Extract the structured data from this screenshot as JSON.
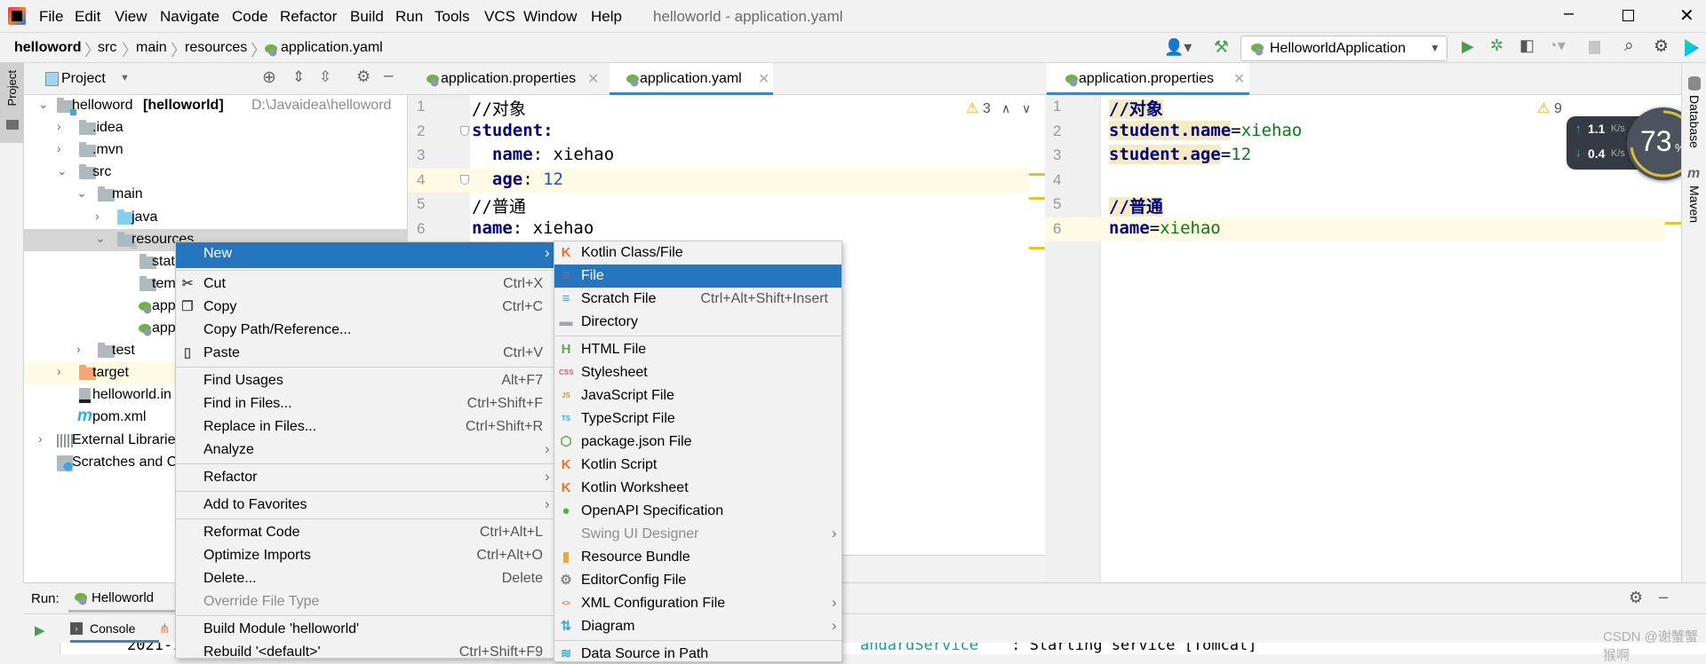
{
  "menubar": {
    "items": [
      "File",
      "Edit",
      "View",
      "Navigate",
      "Code",
      "Refactor",
      "Build",
      "Run",
      "Tools",
      "VCS",
      "Window",
      "Help"
    ],
    "window_title": "helloworld - application.yaml"
  },
  "breadcrumb": [
    "helloword",
    "src",
    "main",
    "resources",
    "application.yaml"
  ],
  "toolbar": {
    "run_config": "HelloworldApplication"
  },
  "left_stripe": {
    "project_tab": "Project"
  },
  "project_panel": {
    "title": "Project",
    "tree": [
      {
        "label": "helloword",
        "module": "[helloworld]",
        "path": "D:\\Javaidea\\helloword",
        "level": 0,
        "arrow": "down",
        "icon": "module"
      },
      {
        "label": ".idea",
        "level": 1,
        "arrow": "right",
        "icon": "folder"
      },
      {
        "label": ".mvn",
        "level": 1,
        "arrow": "right",
        "icon": "folder"
      },
      {
        "label": "src",
        "level": 1,
        "arrow": "down",
        "icon": "folder"
      },
      {
        "label": "main",
        "level": 2,
        "arrow": "down",
        "icon": "folder"
      },
      {
        "label": "java",
        "level": 3,
        "arrow": "right",
        "icon": "source-folder"
      },
      {
        "label": "resources",
        "level": 3,
        "arrow": "down",
        "icon": "resources-folder",
        "selected": true
      },
      {
        "label": "stat",
        "level": 4,
        "icon": "folder"
      },
      {
        "label": "tem",
        "level": 4,
        "icon": "folder"
      },
      {
        "label": "app",
        "level": 4,
        "icon": "spring"
      },
      {
        "label": "app",
        "level": 4,
        "icon": "spring"
      },
      {
        "label": "test",
        "level": 2,
        "arrow": "right",
        "icon": "folder"
      },
      {
        "label": "target",
        "level": 1,
        "arrow": "right",
        "icon": "excluded-folder",
        "highlighted": true
      },
      {
        "label": "helloworld.in",
        "level": 1,
        "icon": "iml"
      },
      {
        "label": "pom.xml",
        "level": 1,
        "icon": "maven"
      },
      {
        "label": "External Librarie",
        "level": 0,
        "arrow": "right",
        "icon": "libraries"
      },
      {
        "label": "Scratches and C",
        "level": 0,
        "icon": "scratches"
      }
    ]
  },
  "editor_left": {
    "tabs": [
      {
        "label": "application.properties",
        "active": false
      },
      {
        "label": "application.yaml",
        "active": true
      }
    ],
    "warnings": "3",
    "current_line": 4,
    "lines": [
      [
        {
          "t": "//对象",
          "c": ""
        }
      ],
      [
        {
          "t": "student:",
          "c": "k"
        }
      ],
      [
        {
          "t": "  ",
          "c": ""
        },
        {
          "t": "name",
          "c": "k"
        },
        {
          "t": ": xiehao",
          "c": ""
        }
      ],
      [
        {
          "t": "  ",
          "c": ""
        },
        {
          "t": "age",
          "c": "k"
        },
        {
          "t": ": ",
          "c": ""
        },
        {
          "t": "12",
          "c": "n"
        }
      ],
      [
        {
          "t": "//普通",
          "c": ""
        }
      ],
      [
        {
          "t": "name",
          "c": "k"
        },
        {
          "t": ": xiehao",
          "c": ""
        }
      ]
    ]
  },
  "editor_right": {
    "tabs": [
      {
        "label": "application.properties",
        "active": true
      }
    ],
    "warnings": "9",
    "current_line": 6,
    "lines": [
      [
        {
          "t": "//对象",
          "c": "k hl"
        }
      ],
      [
        {
          "t": "student.name",
          "c": "k hl"
        },
        {
          "t": "=",
          "c": ""
        },
        {
          "t": "xiehao",
          "c": "v"
        }
      ],
      [
        {
          "t": "student.age",
          "c": "k hl"
        },
        {
          "t": "=",
          "c": ""
        },
        {
          "t": "12",
          "c": "v"
        }
      ],
      [],
      [
        {
          "t": "//普通",
          "c": "k hl"
        }
      ],
      [
        {
          "t": "name",
          "c": "k"
        },
        {
          "t": "=",
          "c": ""
        },
        {
          "t": "xiehao",
          "c": "v"
        }
      ]
    ]
  },
  "net_widget": {
    "upload": "1.1",
    "upload_unit": "K/s",
    "download": "0.4",
    "download_unit": "K/s",
    "percent": "73",
    "percent_sign": "%",
    "percent_value": 73
  },
  "right_stripe": {
    "database": "Database",
    "maven": "Maven"
  },
  "context_menu": {
    "groups": [
      [
        {
          "label": "New",
          "submenu": true,
          "selected": true
        }
      ],
      [
        {
          "label": "Cut",
          "shortcut": "Ctrl+X",
          "icon": "scissors"
        },
        {
          "label": "Copy",
          "shortcut": "Ctrl+C",
          "icon": "copy"
        },
        {
          "label": "Copy Path/Reference..."
        },
        {
          "label": "Paste",
          "shortcut": "Ctrl+V",
          "icon": "clipboard"
        }
      ],
      [
        {
          "label": "Find Usages",
          "shortcut": "Alt+F7"
        },
        {
          "label": "Find in Files...",
          "shortcut": "Ctrl+Shift+F"
        },
        {
          "label": "Replace in Files...",
          "shortcut": "Ctrl+Shift+R"
        },
        {
          "label": "Analyze",
          "submenu": true
        }
      ],
      [
        {
          "label": "Refactor",
          "submenu": true
        }
      ],
      [
        {
          "label": "Add to Favorites",
          "submenu": true
        }
      ],
      [
        {
          "label": "Reformat Code",
          "shortcut": "Ctrl+Alt+L"
        },
        {
          "label": "Optimize Imports",
          "shortcut": "Ctrl+Alt+O"
        },
        {
          "label": "Delete...",
          "shortcut": "Delete"
        },
        {
          "label": "Override File Type",
          "disabled": true
        }
      ],
      [
        {
          "label": "Build Module 'helloworld'"
        },
        {
          "label": "Rebuild '<default>'",
          "shortcut": "Ctrl+Shift+F9"
        }
      ]
    ]
  },
  "new_submenu": {
    "groups": [
      [
        {
          "label": "Kotlin Class/File",
          "icon": "kotlin"
        },
        {
          "label": "File",
          "icon": "file",
          "selected": true
        },
        {
          "label": "Scratch File",
          "shortcut": "Ctrl+Alt+Shift+Insert",
          "icon": "scratch"
        },
        {
          "label": "Directory",
          "icon": "folder"
        }
      ],
      [
        {
          "label": "HTML File",
          "icon": "html"
        },
        {
          "label": "Stylesheet",
          "icon": "css"
        },
        {
          "label": "JavaScript File",
          "icon": "js"
        },
        {
          "label": "TypeScript File",
          "icon": "ts"
        },
        {
          "label": "package.json File",
          "icon": "nodejs"
        },
        {
          "label": "Kotlin Script",
          "icon": "kotlin"
        },
        {
          "label": "Kotlin Worksheet",
          "icon": "kotlin"
        },
        {
          "label": "OpenAPI Specification",
          "icon": "openapi"
        },
        {
          "label": "Swing UI Designer",
          "disabled": true,
          "submenu": true
        },
        {
          "label": "Resource Bundle",
          "icon": "bundle"
        },
        {
          "label": "EditorConfig File",
          "icon": "gear"
        },
        {
          "label": "XML Configuration File",
          "icon": "xml",
          "submenu": true
        },
        {
          "label": "Diagram",
          "icon": "diagram",
          "submenu": true
        }
      ],
      [
        {
          "label": "Data Source in Path",
          "icon": "database"
        }
      ]
    ]
  },
  "run_panel": {
    "label": "Run:",
    "tab": "Helloworld",
    "console_tab": "Console",
    "console_line_left": "2021-12-",
    "console_line_right_class": "andardService",
    "console_line_right_msg": " : Starting service [Tomcat]"
  },
  "watermark": "CSDN @谢蟹蟹猴啊"
}
